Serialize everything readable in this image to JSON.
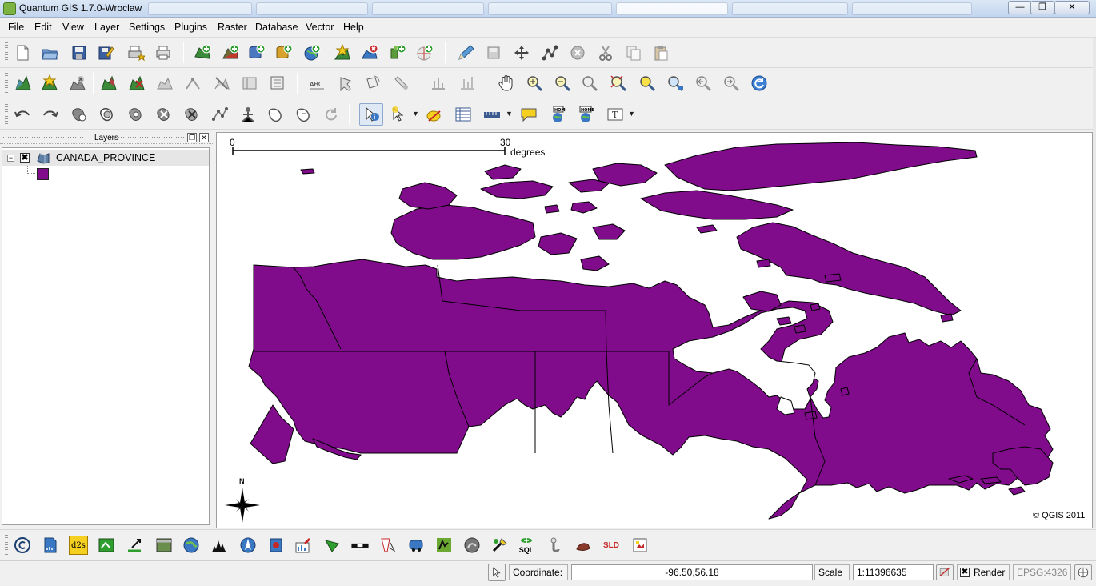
{
  "window": {
    "title": "Quantum GIS 1.7.0-Wroclaw",
    "controls": {
      "minimize": "—",
      "maximize": "❐",
      "close": "✕"
    }
  },
  "menu": [
    "File",
    "Edit",
    "View",
    "Layer",
    "Settings",
    "Plugins",
    "Raster",
    "Database",
    "Vector",
    "Help"
  ],
  "toolbars": {
    "file": [
      "new-project-icon",
      "open-project-icon",
      "save-project-icon",
      "save-as-icon",
      "print-composer-icon",
      "print-icon"
    ],
    "layers": [
      "add-vector-layer-icon",
      "add-raster-layer-icon",
      "add-postgis-layer-icon",
      "add-spatialite-layer-icon",
      "add-wms-layer-icon",
      "new-shapefile-layer-icon",
      "remove-layer-icon",
      "add-wfs-layer-icon",
      "add-gps-layer-icon"
    ],
    "digitizing": [
      "toggle-editing-icon",
      "save-edits-icon",
      "move-feature-icon",
      "node-tool-icon",
      "delete-selected-icon",
      "cut-features-icon",
      "copy-features-icon",
      "paste-features-icon"
    ],
    "attributes": [
      "add-feature-icon",
      "add-part-icon",
      "delete-part-icon",
      "add-ring-icon",
      "delete-ring-icon",
      "reshape-icon",
      "simplify-icon",
      "split-icon",
      "merge-icon",
      "label-icon",
      "move-label-icon",
      "rotate-label-icon",
      "show-pin-icon",
      "move-diagram-icon",
      "pan-icon",
      "zoom-in-icon",
      "zoom-out-icon",
      "zoom-full-icon",
      "zoom-to-selection-icon",
      "zoom-to-layer-icon",
      "zoom-actual-icon",
      "zoom-last-icon",
      "zoom-next-icon",
      "refresh-icon"
    ],
    "advanced": [
      "undo-icon",
      "redo-icon",
      "add-circle-icon",
      "add-ring-2-icon",
      "fill-ring-icon",
      "delete-ring-2-icon",
      "delete-part-2-icon",
      "reshape-2-icon",
      "offset-curve-icon",
      "simplify-2-icon",
      "rotate-point-icon",
      "redo-2-icon",
      "identify-icon",
      "select-icon",
      "deselect-icon",
      "attribute-table-icon",
      "measure-icon",
      "map-tips-icon",
      "new-bookmark-icon",
      "show-bookmarks-icon",
      "text-annotation-icon"
    ]
  },
  "layers_panel": {
    "title": "Layers",
    "layer_name": "CANADA_PROVINCE",
    "fill_color": "#800c8c",
    "visible": "✖",
    "expand": "−"
  },
  "map": {
    "scalebar": {
      "min": "0",
      "max": "30",
      "unit": "degrees"
    },
    "north_label": "N",
    "copyright": "© QGIS 2011",
    "fill_color": "#800c8c"
  },
  "plugin_toolbar": [
    "copyright-label-icon",
    "delimited-text-icon",
    "d2s-icon",
    "georeferencer-icon",
    "interpolation-icon",
    "raster-terrain-icon",
    "globe-icon",
    "histogram-icon",
    "north-arrow-icon",
    "oracle-spatial-icon",
    "quick-print-icon",
    "road-graph-icon",
    "scale-bar-icon",
    "spit-icon",
    "wfs-icon",
    "heatmap-icon",
    "grass-icon",
    "openlayers-icon",
    "sql-icon",
    "python-icon",
    "offline-editing-icon",
    "sld-icon",
    "export-image-icon"
  ],
  "plugin_text": {
    "d2s": "d2s",
    "sql": "SQL",
    "sld": "SLD"
  },
  "status": {
    "coordinate_label": "Coordinate:",
    "coordinate_value": "-96.50,56.18",
    "scale_label": "Scale",
    "scale_value": "1:11396635",
    "render_label": "Render",
    "render_checked": "✖",
    "crs": "EPSG:4326"
  }
}
